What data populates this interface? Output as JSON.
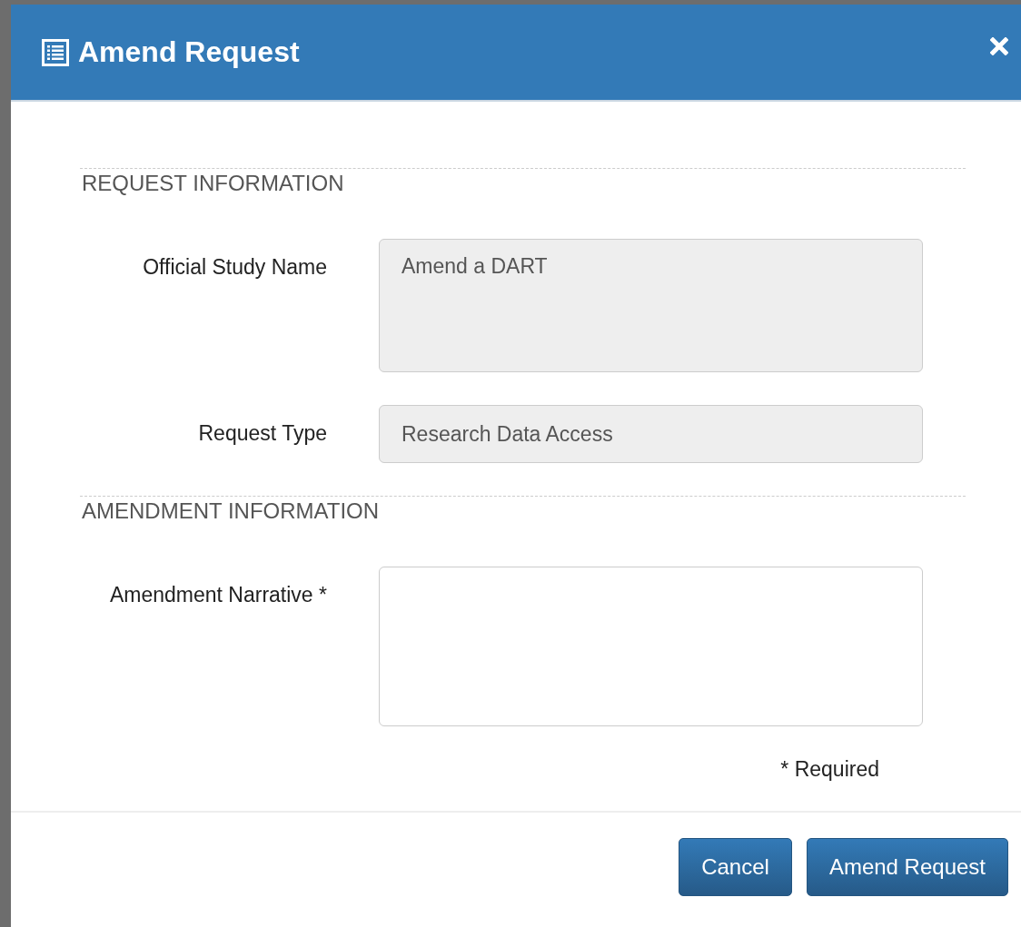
{
  "dialog": {
    "title": "Amend Request"
  },
  "sections": [
    {
      "heading": "REQUEST INFORMATION",
      "fields": [
        {
          "label": "Official Study Name",
          "kind": "textarea",
          "value": "Amend a DART",
          "readonly": true
        },
        {
          "label": "Request Type",
          "kind": "input",
          "value": "Research Data Access",
          "readonly": true
        }
      ]
    },
    {
      "heading": "AMENDMENT INFORMATION",
      "fields": [
        {
          "label": "Amendment Narrative *",
          "kind": "textarea",
          "readonly": false
        }
      ]
    }
  ],
  "required_note": "* Required",
  "buttons": [
    {
      "label": "Cancel"
    },
    {
      "label": "Amend Request"
    }
  ]
}
